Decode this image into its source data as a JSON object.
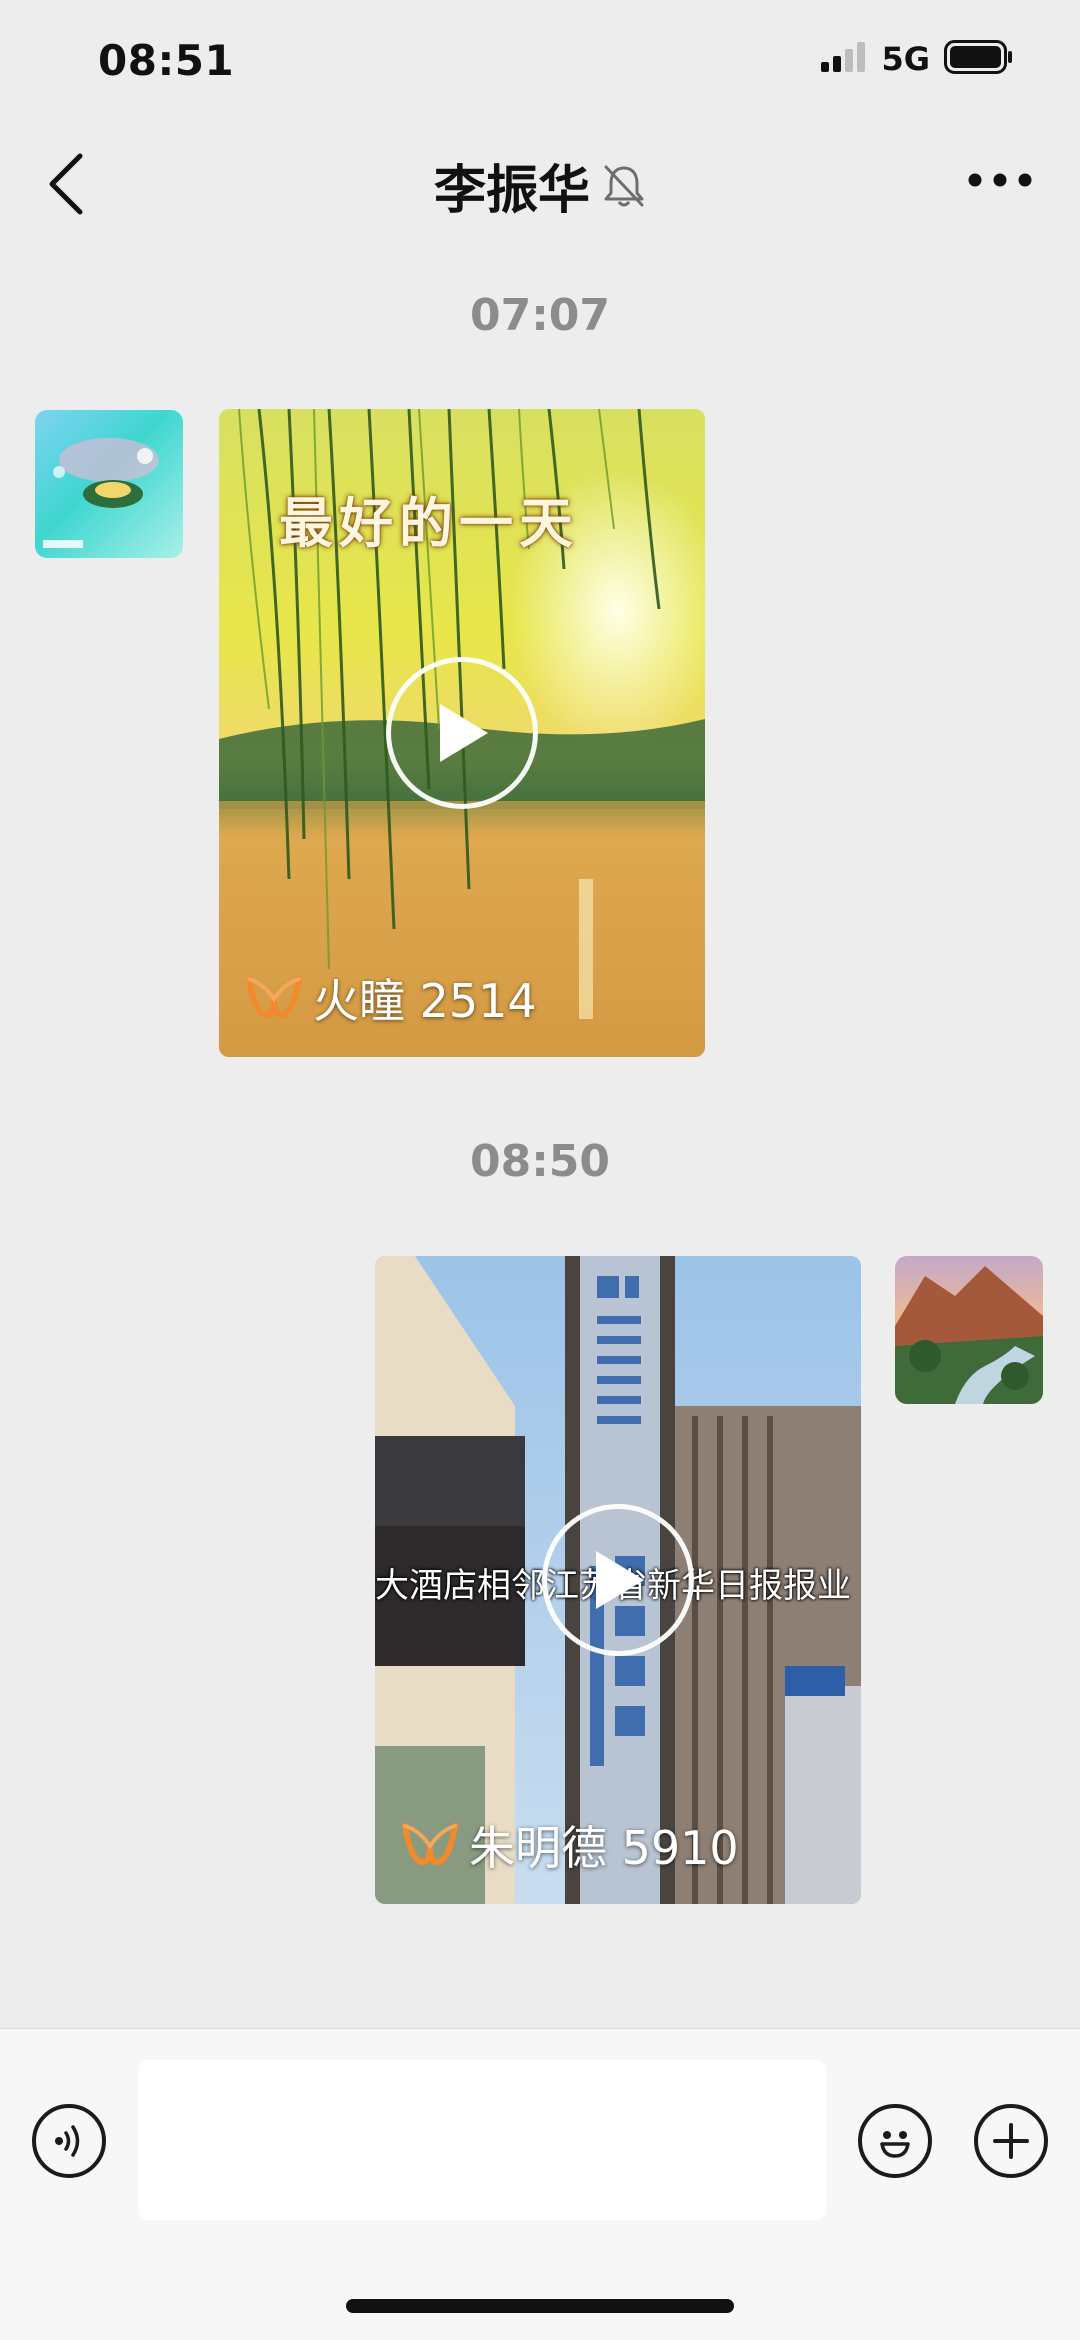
{
  "status_bar": {
    "time": "08:51",
    "network": "5G",
    "icons": [
      "signal-icon",
      "battery-icon"
    ]
  },
  "nav": {
    "title": "李振华",
    "icons": [
      "back-chevron-icon",
      "mute-bell-icon",
      "more-icon"
    ]
  },
  "messages": [
    {
      "timestamp": "07:07",
      "side": "left",
      "avatar_icon": "contact-avatar",
      "video": {
        "overlay_title": "最好的一天",
        "source_name": "火瞳 2514",
        "source_icon": "channel-logo-icon",
        "play_icon": "play-icon"
      }
    },
    {
      "timestamp": "08:50",
      "side": "right",
      "avatar_icon": "self-avatar",
      "video": {
        "caption": "大酒店相邻江苏省新华日报报业",
        "source_name": "朱明德 5910",
        "source_icon": "channel-logo-icon",
        "play_icon": "play-icon"
      }
    }
  ],
  "input_bar": {
    "icons": [
      "voice-icon",
      "emoji-icon",
      "plus-icon"
    ],
    "placeholder": ""
  },
  "colors": {
    "background": "#EDEDED",
    "timestamp": "#8C8C8C",
    "input_bar": "#F7F7F7",
    "channel_logo": "#F08A2C"
  }
}
